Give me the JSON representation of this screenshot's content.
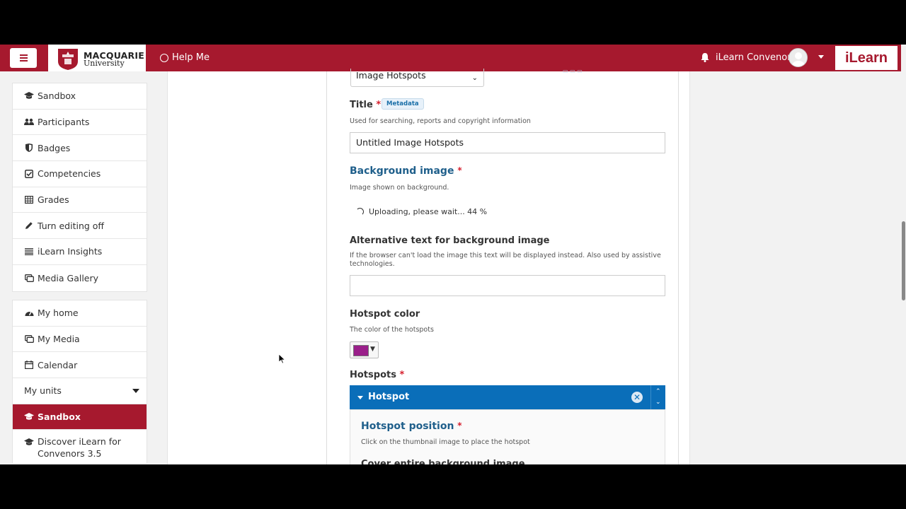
{
  "navbar": {
    "logo_line1": "MACQUARIE",
    "logo_line2": "University",
    "help_label": "Help Me",
    "user_name": "iLearn Convenor",
    "app_logo": "iLearn",
    "brand_color": "#a6192e"
  },
  "sidebar": {
    "course_items": [
      {
        "label": "Sandbox",
        "icon": "graduation-cap-icon"
      },
      {
        "label": "Participants",
        "icon": "users-icon"
      },
      {
        "label": "Badges",
        "icon": "shield-icon"
      },
      {
        "label": "Competencies",
        "icon": "check-square-icon"
      },
      {
        "label": "Grades",
        "icon": "table-icon"
      },
      {
        "label": "Turn editing off",
        "icon": "pencil-icon"
      },
      {
        "label": "iLearn Insights",
        "icon": "list-icon"
      },
      {
        "label": "Media Gallery",
        "icon": "media-icon"
      }
    ],
    "site_items": [
      {
        "label": "My home",
        "icon": "dashboard-icon"
      },
      {
        "label": "My Media",
        "icon": "media-icon"
      },
      {
        "label": "Calendar",
        "icon": "calendar-icon"
      },
      {
        "label": "My units",
        "icon": "chevron-down-icon"
      },
      {
        "label": "Sandbox",
        "icon": "graduation-cap-icon"
      },
      {
        "label": "Discover iLearn for Convenors 3.5",
        "icon": "graduation-cap-icon"
      }
    ]
  },
  "editor": {
    "content_type_value": "Image Hotspots",
    "title_label": "Title",
    "metadata_badge": "Metadata",
    "title_desc": "Used for searching, reports and copyright information",
    "title_value": "Untitled Image Hotspots",
    "bg_image_label": "Background image",
    "bg_image_desc": "Image shown on background.",
    "upload_status": "Uploading, please wait... 44 %",
    "upload_progress_percent": 44,
    "alt_text_label": "Alternative text for background image",
    "alt_text_desc": "If the browser can't load the image this text will be displayed instead. Also used by assistive technologies.",
    "alt_text_value": "",
    "hotspot_color_label": "Hotspot color",
    "hotspot_color_desc": "The color of the hotspots",
    "hotspot_color_value": "#9a1f8a",
    "hotspots_label": "Hotspots",
    "hotspot_item_title": "Hotspot",
    "hotspot_position_label": "Hotspot position",
    "hotspot_position_desc": "Click on the thumbnail image to place the hotspot",
    "cover_label": "Cover entire background image",
    "required_mark": "*"
  }
}
